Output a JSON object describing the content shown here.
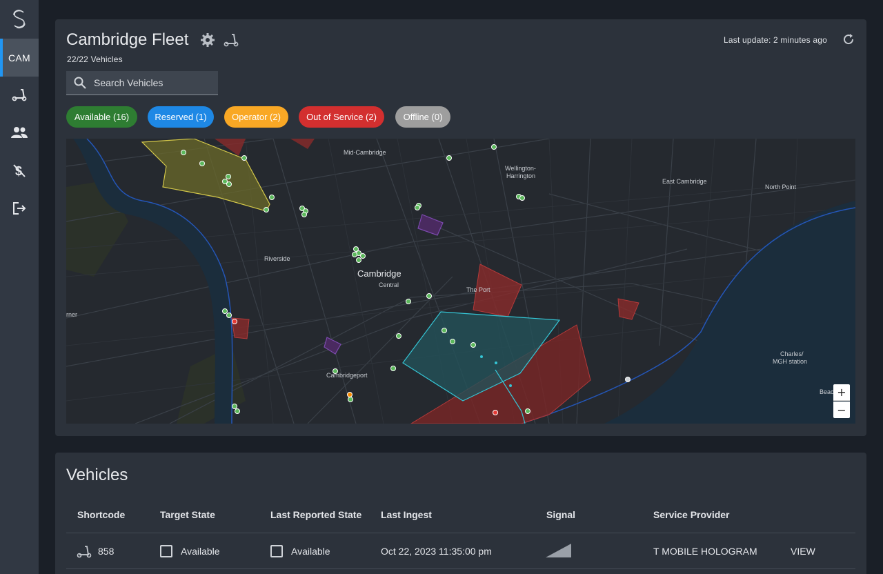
{
  "sidebar": {
    "logo_icon": "s-logo-icon",
    "active_item": "CAM",
    "items": [
      {
        "icon": "scooter-icon"
      },
      {
        "icon": "users-icon"
      },
      {
        "icon": "no-pricing-icon"
      },
      {
        "icon": "logout-icon"
      }
    ]
  },
  "fleet": {
    "title": "Cambridge Fleet",
    "vehicle_count": "22/22 Vehicles",
    "last_update": "Last update: 2 minutes ago",
    "search_placeholder": "Search Vehicles"
  },
  "chips": [
    {
      "label": "Available (16)",
      "color": "#2e7d32"
    },
    {
      "label": "Reserved (1)",
      "color": "#1e88e5"
    },
    {
      "label": "Operator (2)",
      "color": "#f9a825"
    },
    {
      "label": "Out of Service (2)",
      "color": "#d32f2f"
    },
    {
      "label": "Offline (0)",
      "color": "#9e9e9e"
    }
  ],
  "map": {
    "labels": {
      "mid_cambridge": "Mid-Cambridge",
      "wellington": "Wellington-",
      "harrington": "Harrington",
      "east_cambridge": "East Cambridge",
      "north_point": "North Point",
      "riverside": "Riverside",
      "cambridge": "Cambridge",
      "central": "Central",
      "the_port": "The Port",
      "cambridgeport": "Cambridgeport",
      "charles": "Charles/",
      "mgh": "MGH station",
      "rner": "rner",
      "beac": "Beac"
    },
    "zoom_in": "+",
    "zoom_out": "−"
  },
  "vehicles": {
    "title": "Vehicles",
    "columns": [
      "Shortcode",
      "Target State",
      "Last Reported State",
      "Last Ingest",
      "Signal",
      "Service Provider"
    ],
    "rows": [
      {
        "shortcode": "858",
        "target_state": "Available",
        "last_reported_state": "Available",
        "last_ingest": "Oct 22, 2023 11:35:00 pm",
        "service_provider": "T MOBILE HOLOGRAM",
        "action": "VIEW"
      }
    ]
  }
}
